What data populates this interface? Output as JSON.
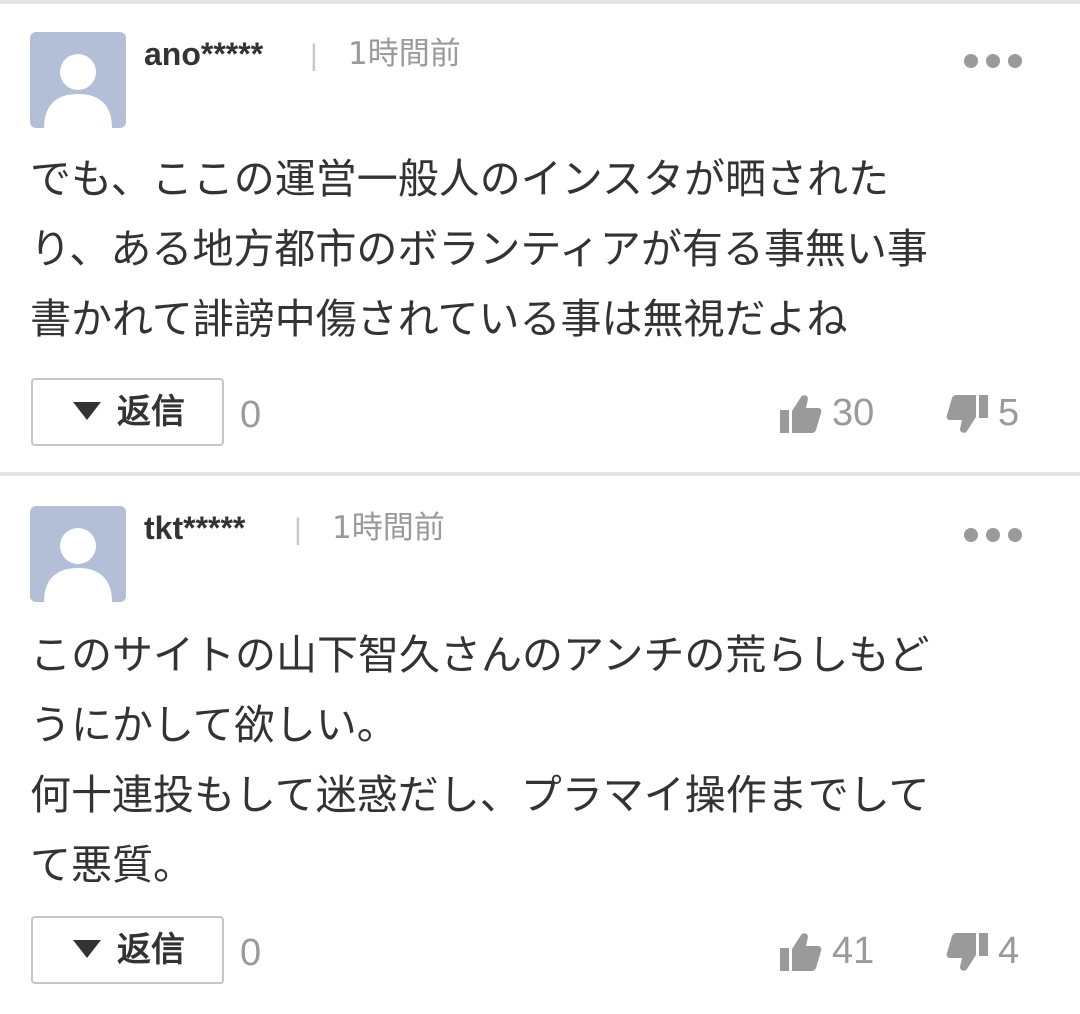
{
  "icons": {
    "avatar": "default-user-silhouette",
    "more": "three-dots-horizontal",
    "reply_caret": "triangle-down",
    "like": "thumbs-up",
    "dislike": "thumbs-down"
  },
  "colors": {
    "avatar_bg": "#b2bfd6",
    "text": "#333333",
    "muted": "#9a9a9a",
    "divider": "#e4e4e4"
  },
  "comments": [
    {
      "username": "ano*****",
      "separator": "|",
      "timestamp": "1時間前",
      "text": "でも、ここの運営一般人のインスタが晒された\nり、ある地方都市のボランティアが有る事無い事\n書かれて誹謗中傷されている事は無視だよね",
      "reply_label": "返信",
      "reply_count": "0",
      "likes": "30",
      "dislikes": "5"
    },
    {
      "username": "tkt*****",
      "separator": "|",
      "timestamp": "1時間前",
      "text": "このサイトの山下智久さんのアンチの荒らしもど\nうにかして欲しい。\n何十連投もして迷惑だし、プラマイ操作までして\nて悪質。",
      "reply_label": "返信",
      "reply_count": "0",
      "likes": "41",
      "dislikes": "4"
    }
  ]
}
